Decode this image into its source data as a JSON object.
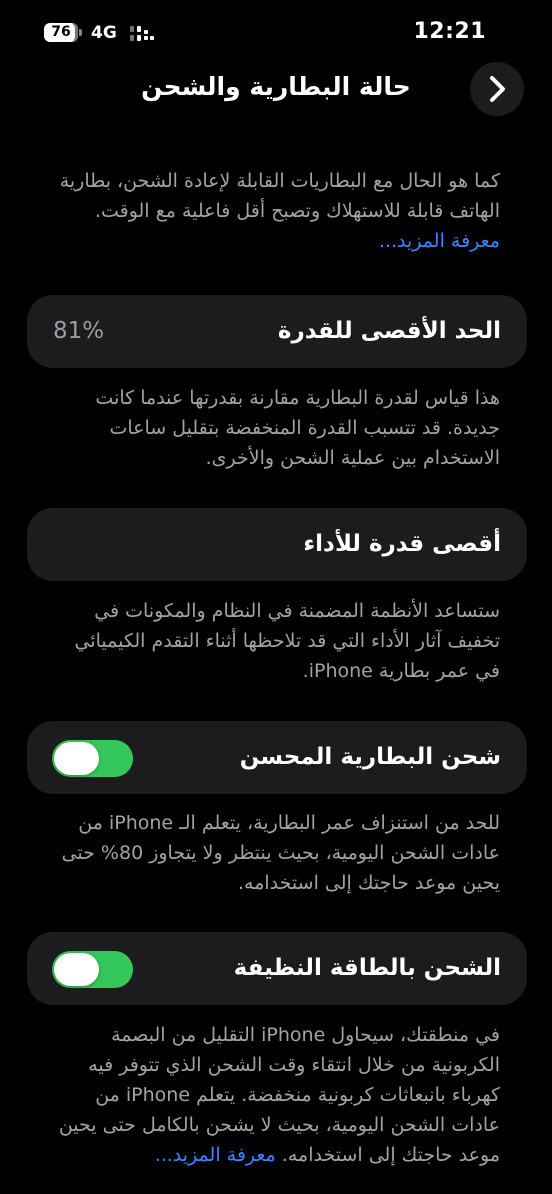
{
  "status": {
    "battery": "76",
    "network": "4G",
    "time": "12:21"
  },
  "nav": {
    "title": "حالة البطارية والشحن"
  },
  "intro": {
    "text": "كما هو الحال مع البطاريات القابلة لإعادة الشحن، بطارية الهاتف قابلة للاستهلاك وتصبح أقل فاعلية مع الوقت.",
    "link": "معرفة المزيد..."
  },
  "max_capacity": {
    "label": "الحد الأقصى للقدرة",
    "value": "81%",
    "description": "هذا قياس لقدرة البطارية مقارنة بقدرتها عندما كانت جديدة. قد تتسبب القدرة المنخفضة بتقليل ساعات الاستخدام بين عملية الشحن والأخرى."
  },
  "peak_performance": {
    "label": "أقصى قدرة للأداء",
    "description": "ستساعد الأنظمة المضمنة في النظام والمكونات في تخفيف آثار الأداء التي قد تلاحظها أثناء التقدم الكيميائي في عمر بطارية iPhone."
  },
  "optimized_charging": {
    "label": "شحن البطارية المحسن",
    "enabled": true,
    "description": "للحد من استنزاف عمر البطارية، يتعلم الـ iPhone من عادات الشحن اليومية، بحيث ينتظر ولا يتجاوز 80% حتى يحين موعد حاجتك إلى استخدامه."
  },
  "clean_energy": {
    "label": "الشحن بالطاقة النظيفة",
    "enabled": true,
    "description": "في منطقتك، سيحاول iPhone التقليل من البصمة الكربونية من خلال انتقاء وقت الشحن الذي تتوفر فيه كهرباء بانبعاثات كربونية منخفضة. يتعلم iPhone من عادات الشحن اليومية، بحيث لا يشحن بالكامل حتى يحين موعد حاجتك إلى استخدامه.",
    "link": "معرفة المزيد..."
  },
  "colors": {
    "background": "#000000",
    "card": "#1c1c1e",
    "toggle_on": "#33c75a",
    "link": "#3a86ff",
    "secondary_text": "#a2a2a8"
  },
  "icons": {
    "back": "chevron-right-icon",
    "signal": "signal-dots-icon"
  }
}
